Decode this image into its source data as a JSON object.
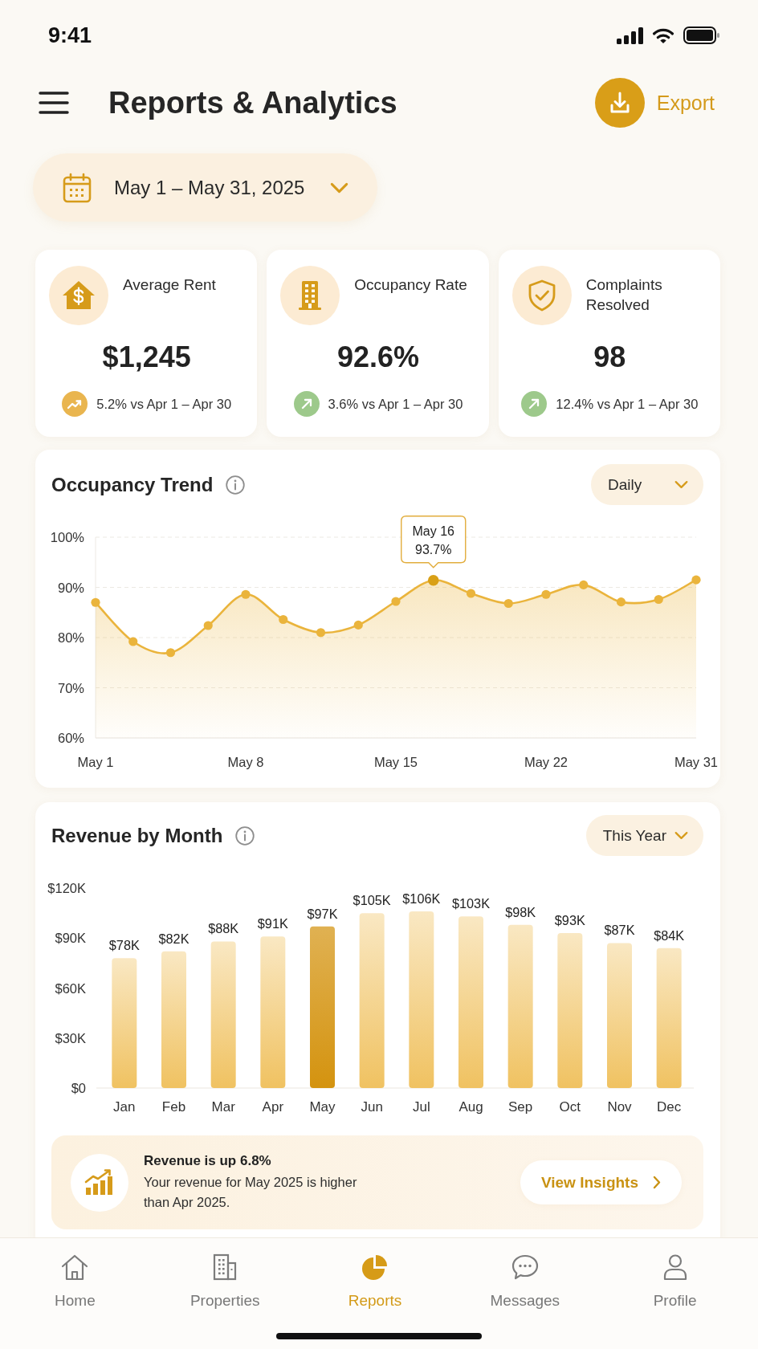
{
  "status_bar": {
    "time": "9:41"
  },
  "header": {
    "title": "Reports & Analytics",
    "export": "Export"
  },
  "date_range": {
    "label": "May 1 – May 31, 2025"
  },
  "kpis": [
    {
      "kind": "rent",
      "label": "Average Rent",
      "value": "$1,245",
      "change": {
        "kind": "trending",
        "text": "5.2% vs Apr 1 – Apr 30",
        "color": "#e9b54f"
      }
    },
    {
      "kind": "building",
      "label": "Occupancy Rate",
      "value": "92.6%",
      "change": {
        "kind": "arrow",
        "text": "3.6% vs Apr 1 – Apr 30",
        "color": "#9dc98b"
      }
    },
    {
      "kind": "shield",
      "label": "Complaints Resolved",
      "value": "98",
      "change": {
        "kind": "arrow",
        "text": "12.4% vs Apr 1 – Apr 30",
        "color": "#9dc98b"
      }
    }
  ],
  "occupancy_trend": {
    "title": "Occupancy Trend",
    "period": "Daily",
    "chart_data": {
      "type": "area",
      "categories": [
        "May 1",
        null,
        null,
        null,
        "May 8",
        null,
        null,
        null,
        "May 15",
        null,
        null,
        null,
        "May 22",
        null,
        null,
        null,
        "May 31"
      ],
      "series": [
        {
          "color": "#eab43c",
          "values": [
            87.0,
            79.2,
            77.0,
            82.4,
            88.6,
            83.6,
            81.0,
            82.5,
            87.2,
            91.4,
            88.8,
            86.8,
            88.6,
            90.5,
            87.1,
            87.6,
            91.5
          ]
        }
      ],
      "ylim": [
        60,
        100
      ],
      "yticks": [
        {
          "value": 60,
          "label": "60%"
        },
        {
          "value": 70,
          "label": "70%"
        },
        {
          "value": 80,
          "label": "80%"
        },
        {
          "value": 90,
          "label": "90%"
        },
        {
          "value": 100,
          "label": "100%"
        }
      ],
      "grid": true,
      "annotations": [
        "May 16",
        "93.7%"
      ]
    },
    "points": [
      {
        "selected": false
      },
      {
        "selected": false
      },
      {
        "selected": false
      },
      {
        "selected": false
      },
      {
        "selected": false
      },
      {
        "selected": false
      },
      {
        "selected": false
      },
      {
        "selected": false
      },
      {
        "selected": false
      },
      {
        "selected": true
      },
      {
        "selected": false
      },
      {
        "selected": false
      },
      {
        "selected": false
      },
      {
        "selected": false
      },
      {
        "selected": false
      },
      {
        "selected": false
      },
      {
        "selected": false
      }
    ]
  },
  "revenue_by_month": {
    "title": "Revenue by Month",
    "period": "This Year",
    "chart_data": {
      "type": "bar",
      "categories": [
        "Jan",
        "Feb",
        "Mar",
        "Apr",
        "May",
        "Jun",
        "Jul",
        "Aug",
        "Sep",
        "Oct",
        "Nov",
        "Dec"
      ],
      "series": [
        {
          "color": "#f0c261",
          "values": [
            78000,
            82000,
            88000,
            91000,
            null,
            105000,
            106000,
            103000,
            98000,
            93000,
            87000,
            84000
          ]
        },
        {
          "color": "#d4930f",
          "values": [
            null,
            null,
            null,
            null,
            97000,
            null,
            null,
            null,
            null,
            null,
            null,
            null
          ]
        }
      ],
      "stacked": true,
      "ylim": [
        0,
        120000
      ],
      "yticks": [
        {
          "value": 0,
          "label": "$0"
        },
        {
          "value": 30000,
          "label": "$30K"
        },
        {
          "value": 60000,
          "label": "$60K"
        },
        {
          "value": 90000,
          "label": "$90K"
        },
        {
          "value": 120000,
          "label": "$120K"
        }
      ],
      "value_labels": [
        "$78K",
        "$82K",
        "$88K",
        "$91K",
        "$97K",
        "$105K",
        "$106K",
        "$103K",
        "$98K",
        "$93K",
        "$87K",
        "$84K"
      ]
    },
    "insight": {
      "title": "Revenue is up 6.8%",
      "text": "Your revenue for May 2025 is higher than Apr 2025.",
      "action": "View Insights"
    }
  },
  "nav": [
    {
      "kind": "home",
      "label": "Home",
      "selected": false
    },
    {
      "kind": "properties",
      "label": "Properties",
      "selected": false
    },
    {
      "kind": "reports",
      "label": "Reports",
      "selected": true
    },
    {
      "kind": "messages",
      "label": "Messages",
      "selected": false
    },
    {
      "kind": "profile",
      "label": "Profile",
      "selected": false
    }
  ]
}
